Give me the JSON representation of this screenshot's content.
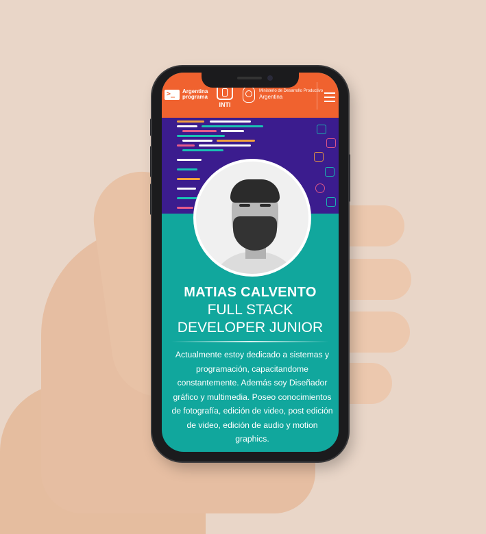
{
  "header": {
    "argentina_programa_icon": ">_",
    "argentina_programa_label": "Argentina programa",
    "inti_label": "INTI",
    "ministry_line": "Ministerio de Desarrollo Productivo",
    "ministry_country": "Argentina"
  },
  "profile": {
    "name": "MATIAS CALVENTO",
    "role_line1": "FULL STACK",
    "role_line2": "DEVELOPER JUNIOR",
    "bio": "Actualmente estoy dedicado a sistemas y programación, capacitandome constantemente. Además soy Diseñador gráfico y multimedia. Poseo conocimientos de fotografía, edición de video, post edición de video, edición de audio y motion graphics."
  },
  "colors": {
    "header_bg": "#f0622f",
    "banner_bg": "#3b1c8e",
    "body_bg": "#11a79d",
    "text": "#ffffff"
  },
  "icons": [
    "terminal-logo-icon",
    "inti-logo-icon",
    "argentina-crest-icon",
    "hamburger-menu-icon"
  ]
}
